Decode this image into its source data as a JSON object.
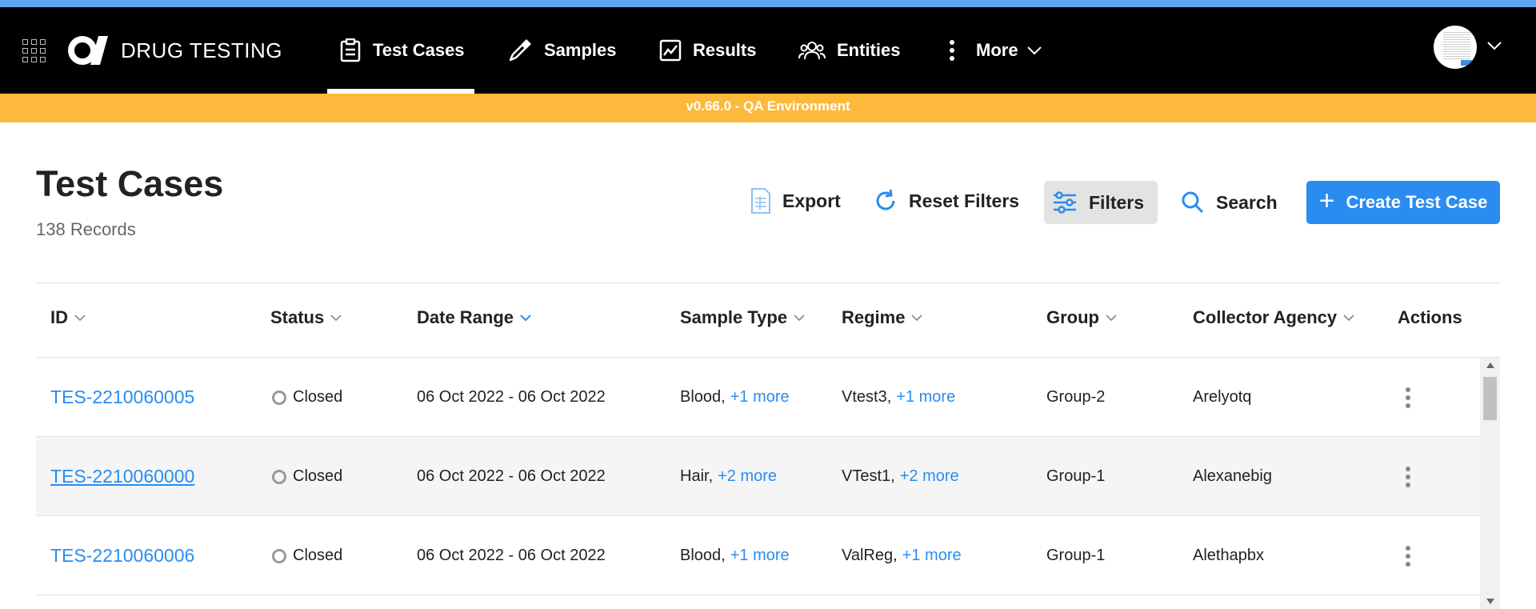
{
  "colors": {
    "accent": "#2a8cf0",
    "env_banner": "#fdb93b",
    "top_strip": "#5aa6f2",
    "navbar": "#000000"
  },
  "nav": {
    "brand": "DRUG TESTING",
    "items": [
      {
        "label": "Test Cases",
        "icon": "clipboard-icon",
        "active": true
      },
      {
        "label": "Samples",
        "icon": "pipette-icon",
        "active": false
      },
      {
        "label": "Results",
        "icon": "chart-icon",
        "active": false
      },
      {
        "label": "Entities",
        "icon": "users-icon",
        "active": false
      },
      {
        "label": "More",
        "icon": "kebab-icon",
        "active": false
      }
    ]
  },
  "env_banner": "v0.66.0 - QA Environment",
  "page": {
    "title": "Test Cases",
    "records": "138 Records"
  },
  "toolbar": {
    "export": "Export",
    "reset_filters": "Reset Filters",
    "filters": "Filters",
    "search": "Search",
    "create": "Create Test Case"
  },
  "table": {
    "columns": [
      "ID",
      "Status",
      "Date Range",
      "Sample Type",
      "Regime",
      "Group",
      "Collector Agency",
      "Actions"
    ],
    "rows": [
      {
        "id": "TES-2210060005",
        "status": "Closed",
        "date_range": "06 Oct 2022 - 06 Oct 2022",
        "sample_type": "Blood,",
        "sample_more": "+1 more",
        "regime": "Vtest3,",
        "regime_more": "+1 more",
        "group": "Group-2",
        "agency": "Arelyotq"
      },
      {
        "id": "TES-2210060000",
        "status": "Closed",
        "date_range": "06 Oct 2022 - 06 Oct 2022",
        "sample_type": "Hair,",
        "sample_more": "+2 more",
        "regime": "VTest1,",
        "regime_more": "+2 more",
        "group": "Group-1",
        "agency": "Alexanebig"
      },
      {
        "id": "TES-2210060006",
        "status": "Closed",
        "date_range": "06 Oct 2022 - 06 Oct 2022",
        "sample_type": "Blood,",
        "sample_more": "+1 more",
        "regime": "ValReg,",
        "regime_more": "+1 more",
        "group": "Group-1",
        "agency": "Alethapbx"
      }
    ]
  }
}
